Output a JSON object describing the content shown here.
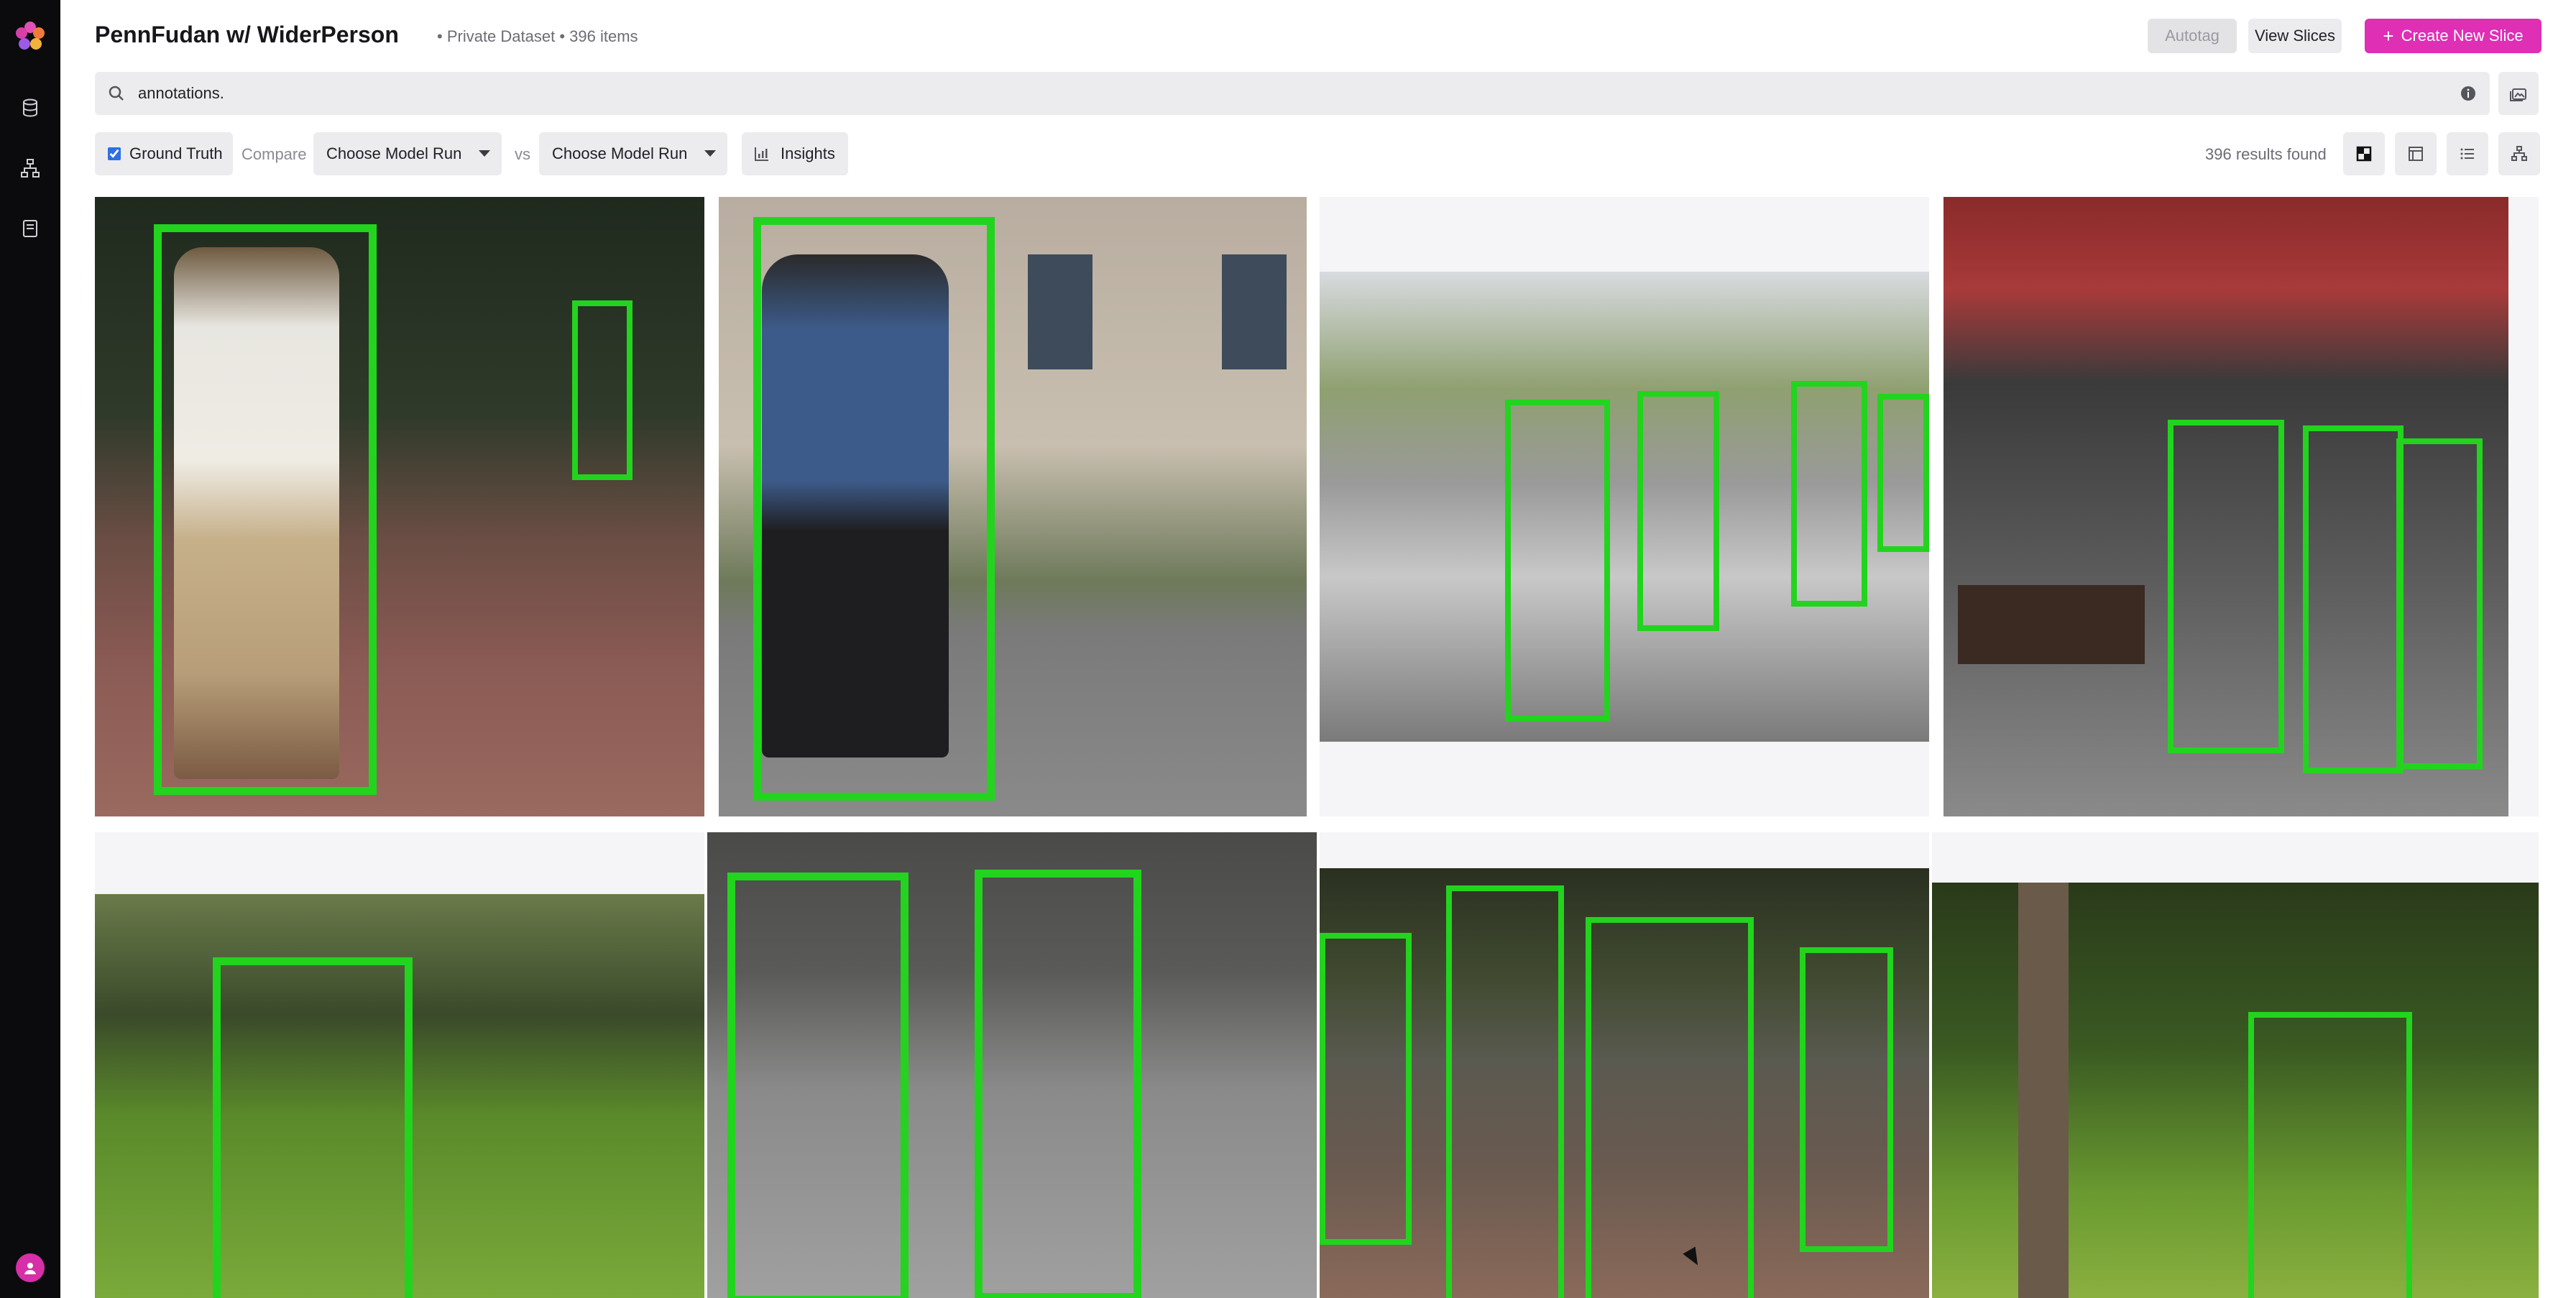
{
  "header": {
    "title": "PennFudan w/ WiderPerson",
    "subtitle": "• Private Dataset • 396 items",
    "autotag_label": "Autotag",
    "view_slices_label": "View Slices",
    "create_slice_label": "Create New Slice"
  },
  "search": {
    "value": "annotations.",
    "icon": "search-icon"
  },
  "toolbar": {
    "ground_truth_label": "Ground Truth",
    "ground_truth_checked": true,
    "compare_label": "Compare",
    "model_run_1": "Choose Model Run",
    "vs_label": "vs",
    "model_run_2": "Choose Model Run",
    "insights_label": "Insights",
    "results_text": "396 results found"
  },
  "sidebar": {
    "items": [
      "logo-icon",
      "dataset-icon",
      "hierarchy-icon",
      "notebook-icon",
      "user-avatar-icon"
    ]
  },
  "gallery": {
    "annotation_color": "#22d41e",
    "items": [
      {
        "name": "image-1",
        "boxes": 2
      },
      {
        "name": "image-2",
        "boxes": 1
      },
      {
        "name": "image-3",
        "boxes": 4
      },
      {
        "name": "image-4",
        "boxes": 3
      },
      {
        "name": "image-5",
        "boxes": 1
      },
      {
        "name": "image-6",
        "boxes": 2
      },
      {
        "name": "image-7",
        "boxes": 4
      },
      {
        "name": "image-8",
        "boxes": 1
      }
    ]
  },
  "colors": {
    "accent": "#de2fb5",
    "sidebar_bg": "#0b0b0d",
    "chip_bg": "#ececef"
  }
}
